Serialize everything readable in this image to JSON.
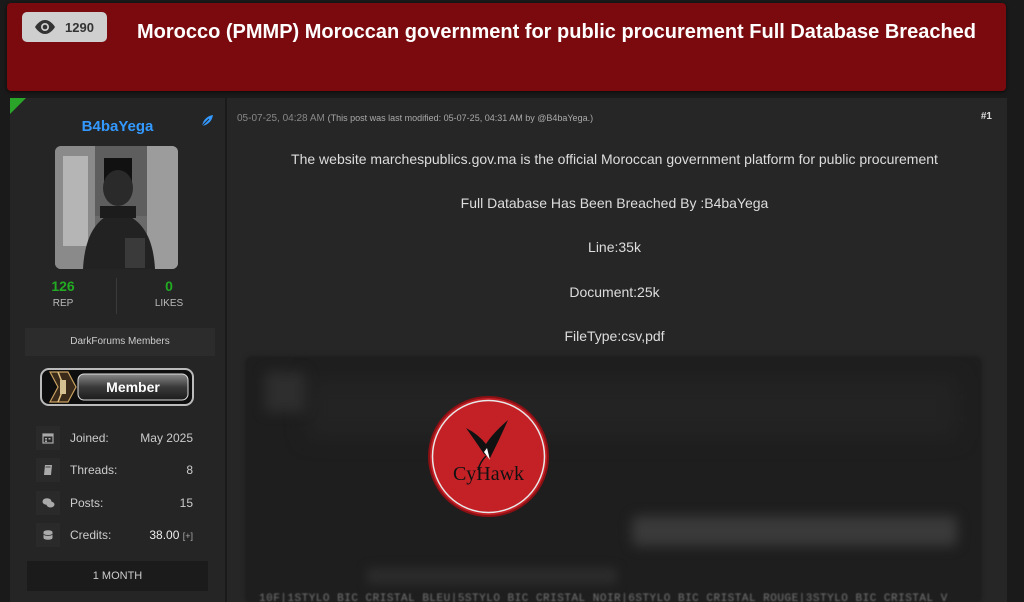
{
  "thread": {
    "views": "1290",
    "title": "Morocco (PMMP) Moroccan government for public procurement Full Database Breached"
  },
  "user": {
    "username": "B4baYega",
    "rep_value": "126",
    "rep_label": "REP",
    "likes_value": "0",
    "likes_label": "LIKES",
    "group": "DarkForums Members",
    "badge_label": "Member",
    "info": [
      {
        "icon": "calendar-icon",
        "label": "Joined:",
        "value": "May 2025"
      },
      {
        "icon": "book-icon",
        "label": "Threads:",
        "value": "8"
      },
      {
        "icon": "comments-icon",
        "label": "Posts:",
        "value": "15"
      },
      {
        "icon": "coins-icon",
        "label": "Credits:",
        "value": "38.00",
        "extra": "[+]"
      }
    ],
    "membership": "1 MONTH"
  },
  "post": {
    "date": "05-07-25, 04:28 AM",
    "modified": "(This post was last modified: 05-07-25, 04:31 AM by @B4baYega.)",
    "number": "#1",
    "lines": [
      "The website marchespublics.gov.ma is the official Moroccan government platform for public procurement",
      "Full Database Has Been Breached By :B4baYega",
      "Line:35k",
      "Document:25k",
      "FileType:csv,pdf"
    ],
    "logo_text": "CyHawk",
    "blurred_text": "10F|1STYLO BIC CRISTAL BLEU|5STYLO BIC CRISTAL NOIR|6STYLO BIC CRISTAL ROUGE|3STYLO BIC CRISTAL V"
  },
  "colors": {
    "header_bg": "#7a0a0e",
    "username": "#3399ff",
    "stat_value": "#22aa22",
    "logo_red": "#c42127"
  }
}
